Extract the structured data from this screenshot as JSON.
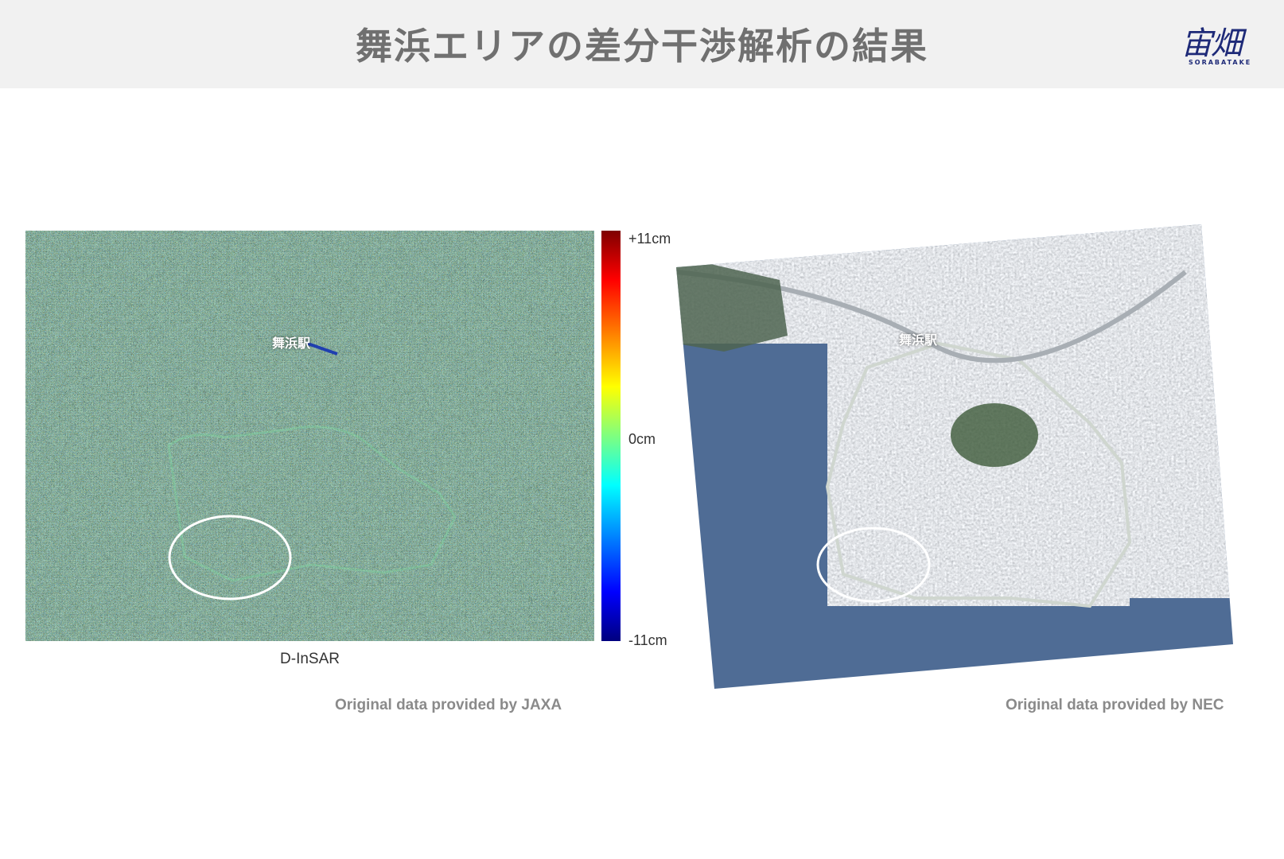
{
  "header": {
    "title": "舞浜エリアの差分干渉解析の結果",
    "logo_text": "宙畑",
    "logo_subtext": "SORABATAKE"
  },
  "insar_panel": {
    "station_label": "舞浜駅",
    "caption": "D-InSAR",
    "credit": "Original data provided by JAXA"
  },
  "colorbar": {
    "max_label": "+11cm",
    "mid_label": "0cm",
    "min_label": "-11cm",
    "colors": [
      "#7f0000",
      "#ff0000",
      "#ff7f00",
      "#ffff00",
      "#7fff7f",
      "#00ffff",
      "#007fff",
      "#0000ff",
      "#00007f"
    ]
  },
  "optical_panel": {
    "station_label": "舞浜駅",
    "credit": "Original data provided by NEC"
  },
  "colors": {
    "header_bg": "#f1f1f1",
    "title": "#707070",
    "logo": "#1e2a78",
    "credit": "#8a8a8a",
    "water": "#4f6c95",
    "highlight_ellipse": "#ffffff"
  }
}
